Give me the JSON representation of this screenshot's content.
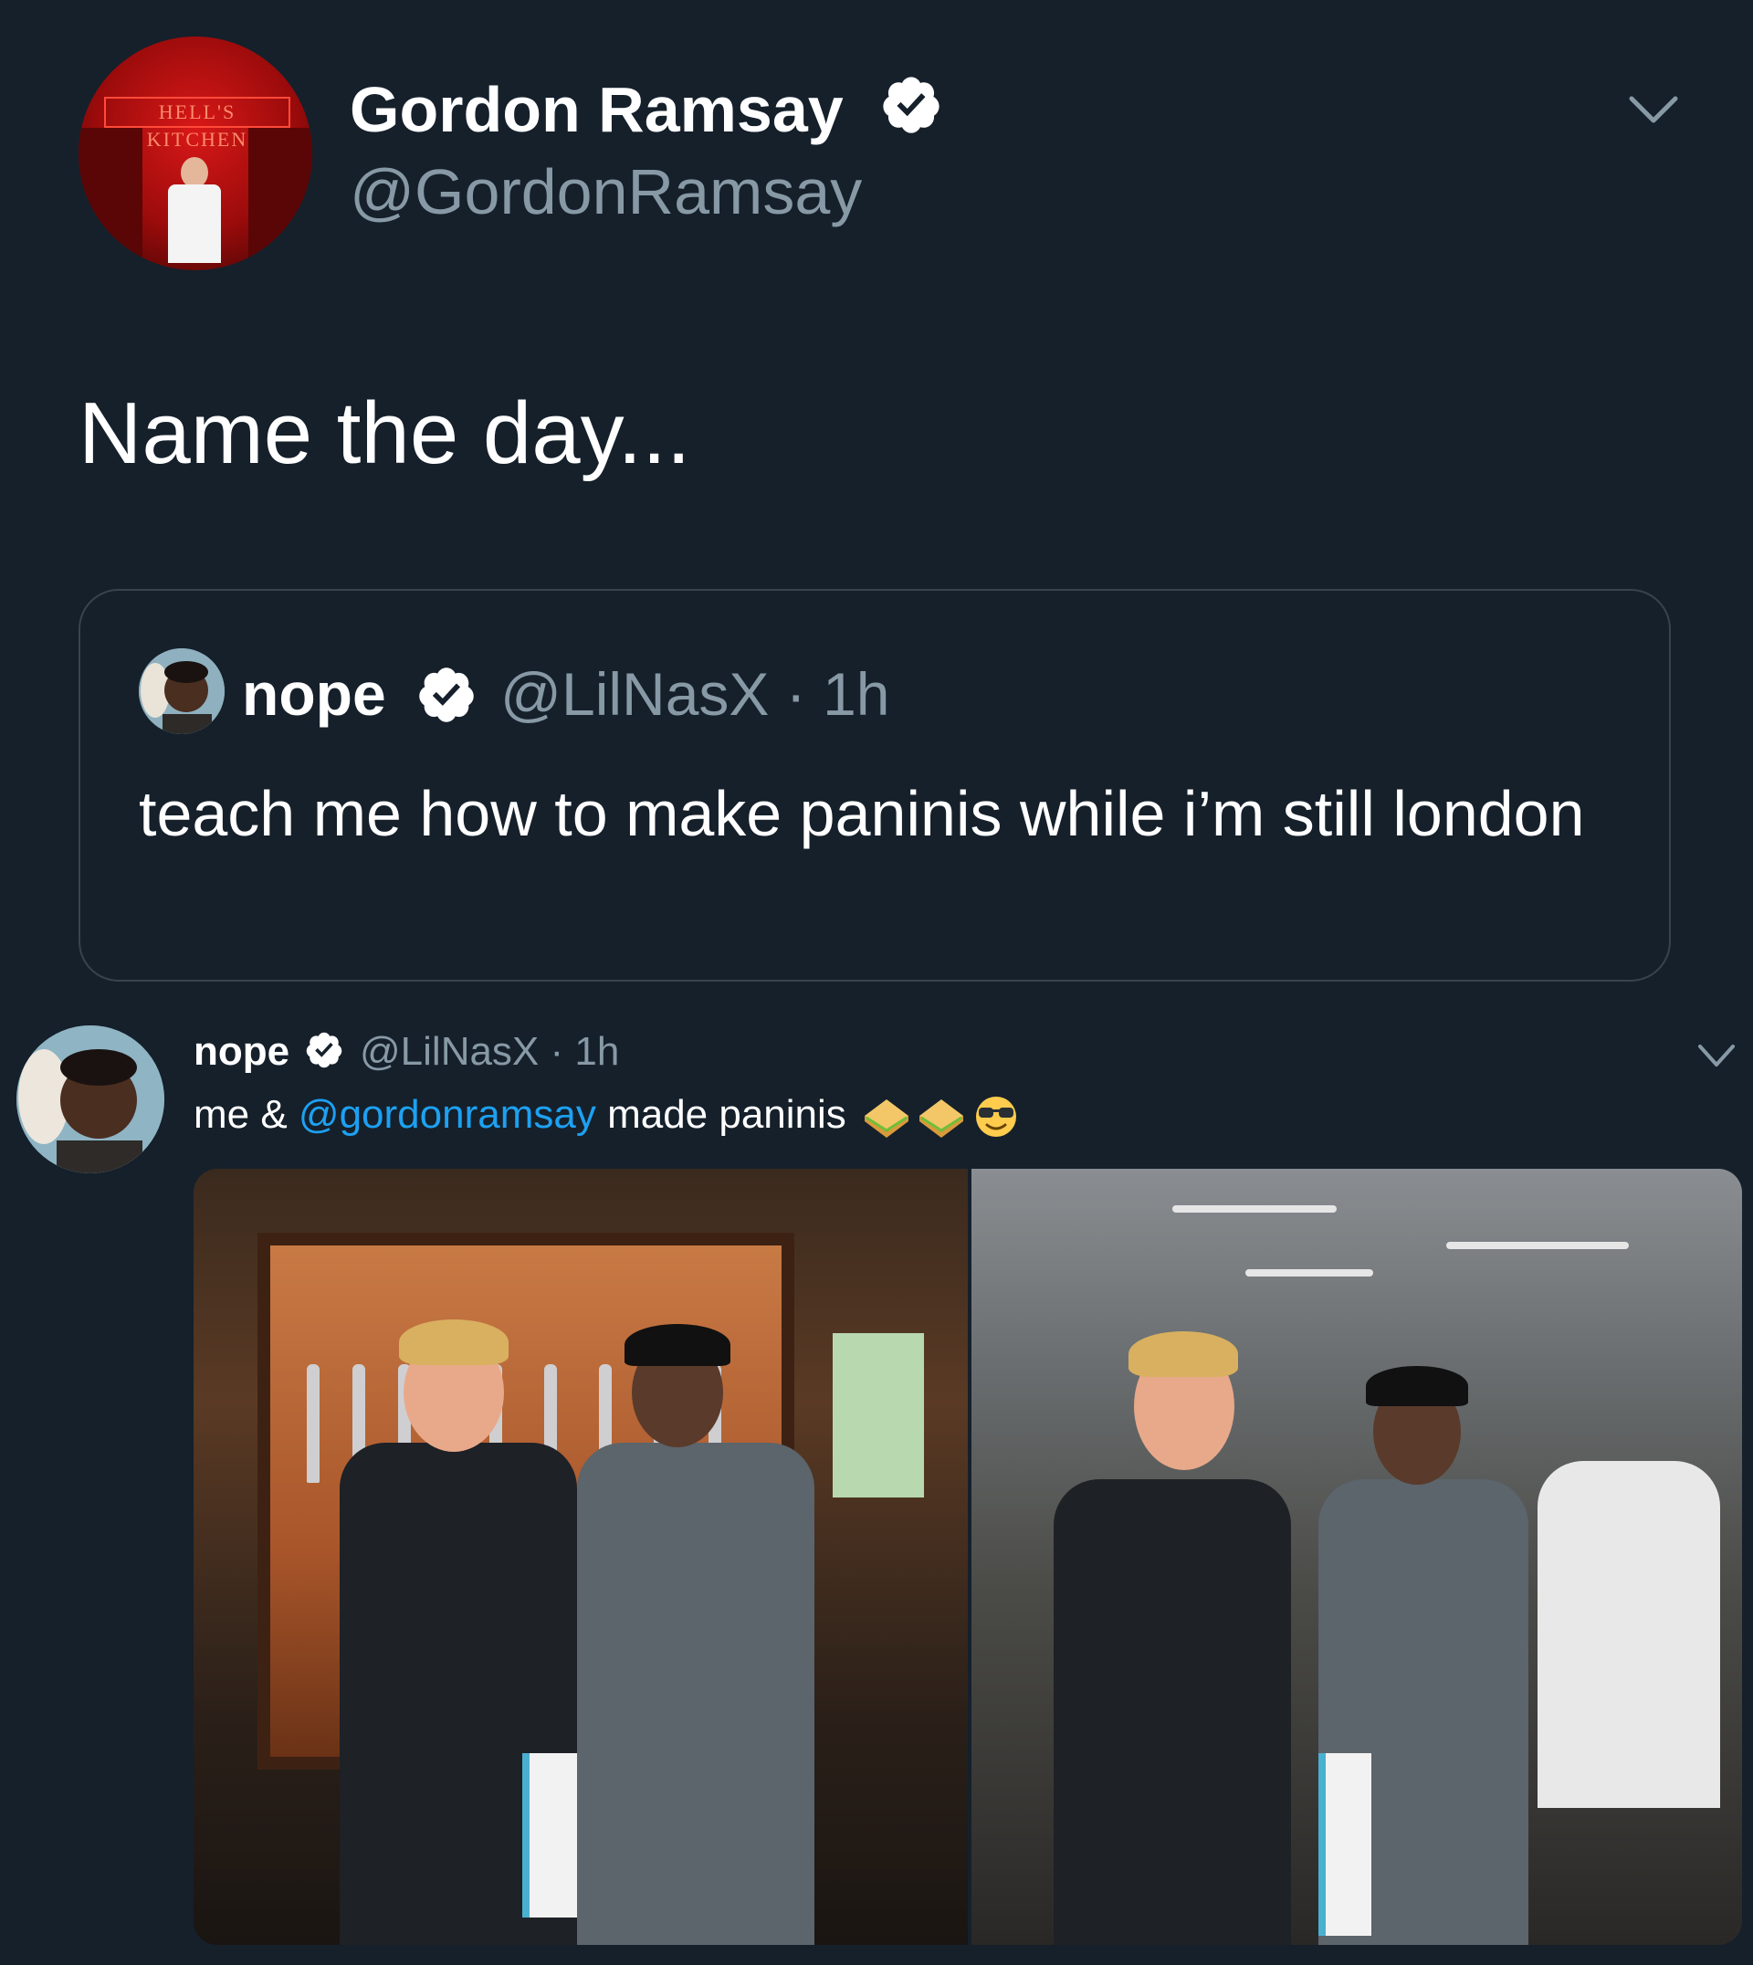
{
  "tweet": {
    "display_name": "Gordon Ramsay",
    "handle": "@GordonRamsay",
    "text": "Name the day...",
    "verified": true,
    "avatar_sign": "HELL'S KITCHEN"
  },
  "quoted_tweet": {
    "display_name": "nope",
    "handle_time": "@LilNasX · 1h",
    "verified": true,
    "text": "teach me how to make paninis while i’m still london"
  },
  "embedded_tweet": {
    "display_name": "nope",
    "handle_time": "@LilNasX · 1h",
    "verified": true,
    "text_before": "me & ",
    "mention": "@gordonramsay",
    "text_after": " made paninis",
    "emojis": [
      "sandwich-emoji",
      "sandwich-emoji",
      "sunglasses-emoji"
    ]
  },
  "colors": {
    "background": "#15202b",
    "secondary_text": "#8899a6",
    "link": "#1da1f2",
    "border": "#38444d"
  },
  "icons": {
    "verified": "verified-badge-icon",
    "chevron": "chevron-down-icon"
  }
}
